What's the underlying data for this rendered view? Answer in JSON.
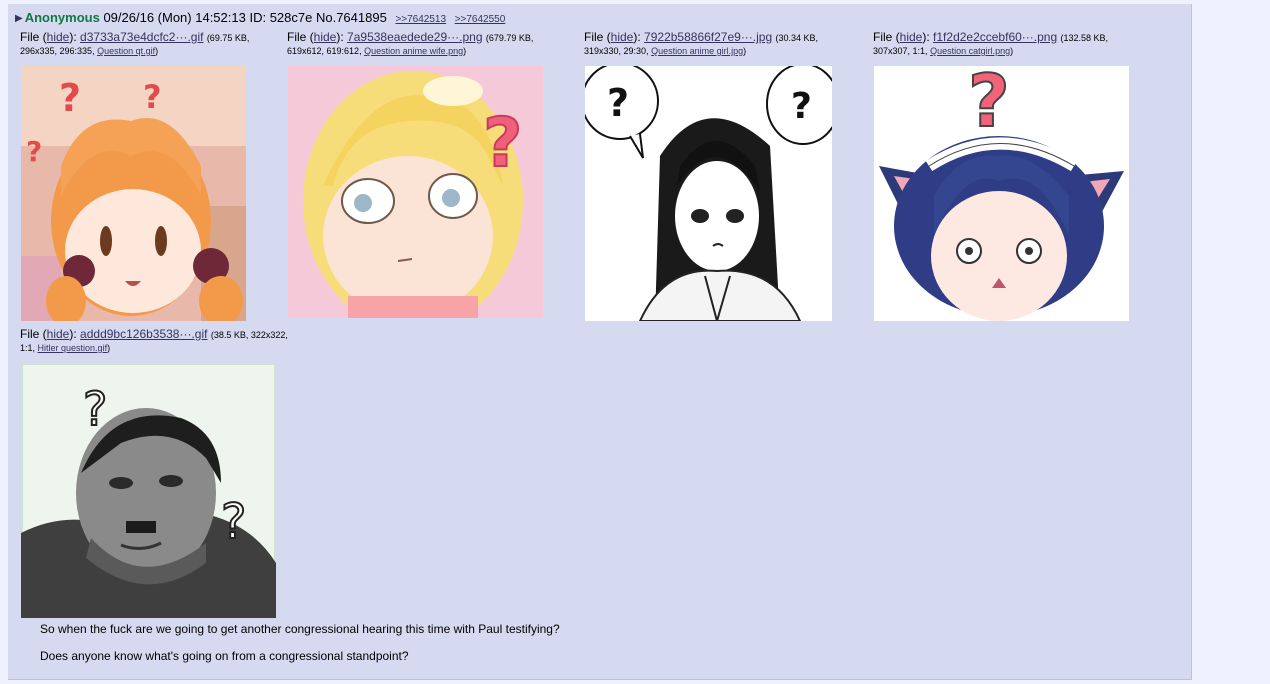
{
  "post": {
    "name": "Anonymous",
    "datetime": "09/26/16 (Mon) 14:52:13",
    "id_label": "ID: 528c7e",
    "number": "No.7641895",
    "replies": [
      ">>7642513",
      ">>7642550"
    ]
  },
  "files": [
    {
      "prefix": "File (",
      "hide": "hide",
      "after_hide": "):",
      "filename": "d3733a73e4dcfc2···.gif",
      "size": "(69.75 KB,",
      "dims": "296x335, 296:335,",
      "original": "Question qt.gif",
      "close": ")"
    },
    {
      "prefix": "File (",
      "hide": "hide",
      "after_hide": "):",
      "filename": "7a9538eaedede29···.png",
      "size": "(679.79 KB,",
      "dims": "619x612, 619:612,",
      "original": "Question anime wife.png",
      "close": ")"
    },
    {
      "prefix": "File (",
      "hide": "hide",
      "after_hide": "):",
      "filename": "7922b58866f27e9···.jpg",
      "size": "(30.34 KB,",
      "dims": "319x330, 29:30,",
      "original": "Question anime girl.jpg",
      "close": ")"
    },
    {
      "prefix": "File (",
      "hide": "hide",
      "after_hide": "):",
      "filename": "f1f2d2e2ccebf60···.png",
      "size": "(132.58 KB,",
      "dims": "307x307, 1:1,",
      "original": "Question catgirl.png",
      "close": ")"
    },
    {
      "prefix": "File (",
      "hide": "hide",
      "after_hide": "):",
      "filename": "addd9bc126b3538···.gif",
      "size": "(38.5 KB, 322x322,",
      "dims": "1:1,",
      "original": "Hitler question.gif",
      "close": ")"
    }
  ],
  "comment": [
    "So when the fuck are we going to get another congressional hearing this time with Paul testifying?",
    "Does anyone know what's going on from a congressional standpoint?"
  ],
  "colors": {
    "background": "#eef2ff",
    "post_bg": "#d6daf0",
    "name": "#117743",
    "link": "#34345c"
  }
}
